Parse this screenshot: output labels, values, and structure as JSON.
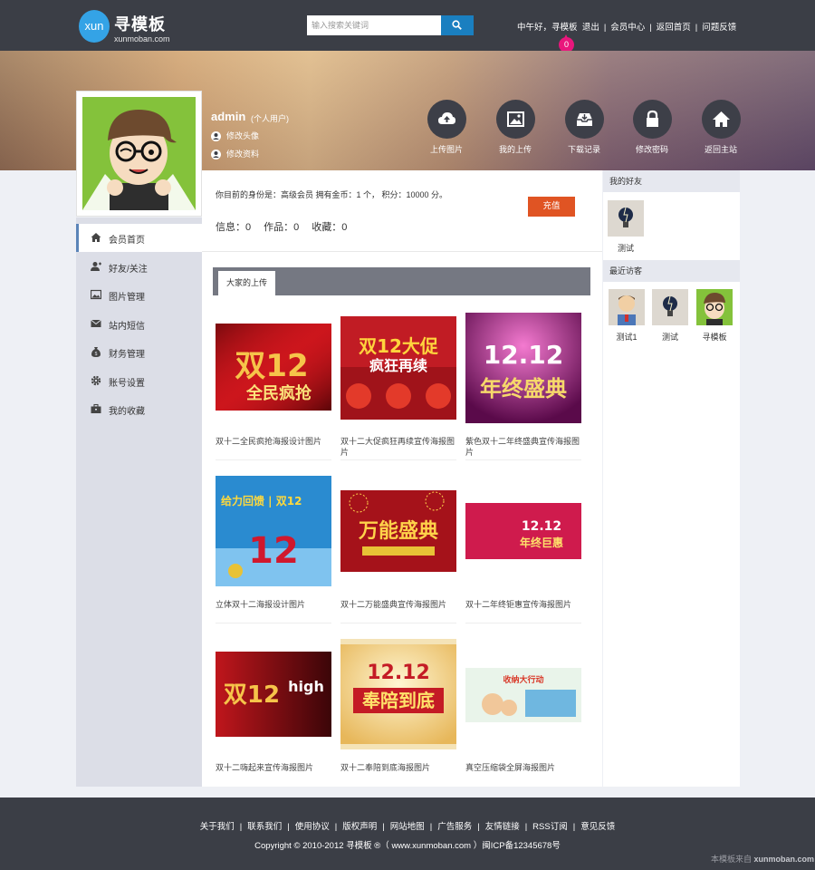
{
  "header": {
    "logo_mark": "xun",
    "logo_name": "寻模板",
    "logo_url": "xunmoban.com",
    "search_placeholder": "输入搜索关键词",
    "greeting": "中午好，",
    "current_user": "寻模板",
    "logout": "退出",
    "links": [
      "会员中心",
      "返回首页",
      "问题反馈"
    ],
    "notification_count": "0"
  },
  "profile": {
    "username": "admin",
    "user_type": "(个人用户)",
    "change_avatar": "修改头像",
    "edit_profile": "修改资料"
  },
  "quick_actions": [
    {
      "label": "上传图片",
      "icon": "cloud-upload-icon"
    },
    {
      "label": "我的上传",
      "icon": "image-icon"
    },
    {
      "label": "下载记录",
      "icon": "inbox-download-icon"
    },
    {
      "label": "修改密码",
      "icon": "lock-icon"
    },
    {
      "label": "返回主站",
      "icon": "home-icon"
    }
  ],
  "sidebar": {
    "items": [
      {
        "label": "会员首页",
        "icon": "home-icon",
        "active": true
      },
      {
        "label": "好友/关注",
        "icon": "user-add-icon"
      },
      {
        "label": "图片管理",
        "icon": "picture-icon"
      },
      {
        "label": "站内短信",
        "icon": "envelope-icon"
      },
      {
        "label": "财务管理",
        "icon": "money-bag-icon"
      },
      {
        "label": "账号设置",
        "icon": "gear-icon"
      },
      {
        "label": "我的收藏",
        "icon": "briefcase-icon"
      }
    ]
  },
  "member": {
    "status_line": "你目前的身份是：高级会员 拥有金币：1 个， 积分：10000 分。",
    "recharge": "充值",
    "stats": [
      "信息：0",
      "作品：0",
      "收藏：0"
    ]
  },
  "tab": {
    "label": "大家的上传"
  },
  "uploads": [
    {
      "caption": "双十二全民疯抢海报设计图片",
      "art": "red-gold"
    },
    {
      "caption": "双十二大促疯狂再续宣传海报图片",
      "art": "red-multi"
    },
    {
      "caption": "紫色双十二年终盛典宣传海报图片",
      "art": "purple"
    },
    {
      "caption": "立体双十二海报设计图片",
      "art": "blue"
    },
    {
      "caption": "双十二万能盛典宣传海报图片",
      "art": "red-fireworks"
    },
    {
      "caption": "双十二年终钜惠宣传海报图片",
      "art": "pink"
    },
    {
      "caption": "双十二嗨起来宣传海报图片",
      "art": "dark-red"
    },
    {
      "caption": "双十二奉陪到底海报图片",
      "art": "gold"
    },
    {
      "caption": "真空压缩袋全屏海报图片",
      "art": "light"
    }
  ],
  "right": {
    "friends_title": "我的好友",
    "friends": [
      {
        "name": "测试",
        "avatar": "bulb-avatar"
      }
    ],
    "visitors_title": "最近访客",
    "visitors": [
      {
        "name": "测试1",
        "avatar": "man-avatar"
      },
      {
        "name": "测试",
        "avatar": "bulb-avatar"
      },
      {
        "name": "寻模板",
        "avatar": "cartoon-avatar"
      }
    ]
  },
  "footer": {
    "links": [
      "关于我们",
      "联系我们",
      "使用协议",
      "版权声明",
      "网站地图",
      "广告服务",
      "友情链接",
      "RSS订阅",
      "意见反馈"
    ],
    "copyright": "Copyright © 2010-2012 寻模板 ®（ www.xunmoban.com ）闽ICP备12345678号",
    "watermark_prefix": "本模板来自",
    "watermark_site": "xunmoban.com"
  },
  "colors": {
    "topbar": "#3b3e46",
    "accent_blue": "#1a7fc0",
    "recharge": "#e05423",
    "notification": "#e9167c",
    "sidebar_bg": "#dcdee7"
  }
}
